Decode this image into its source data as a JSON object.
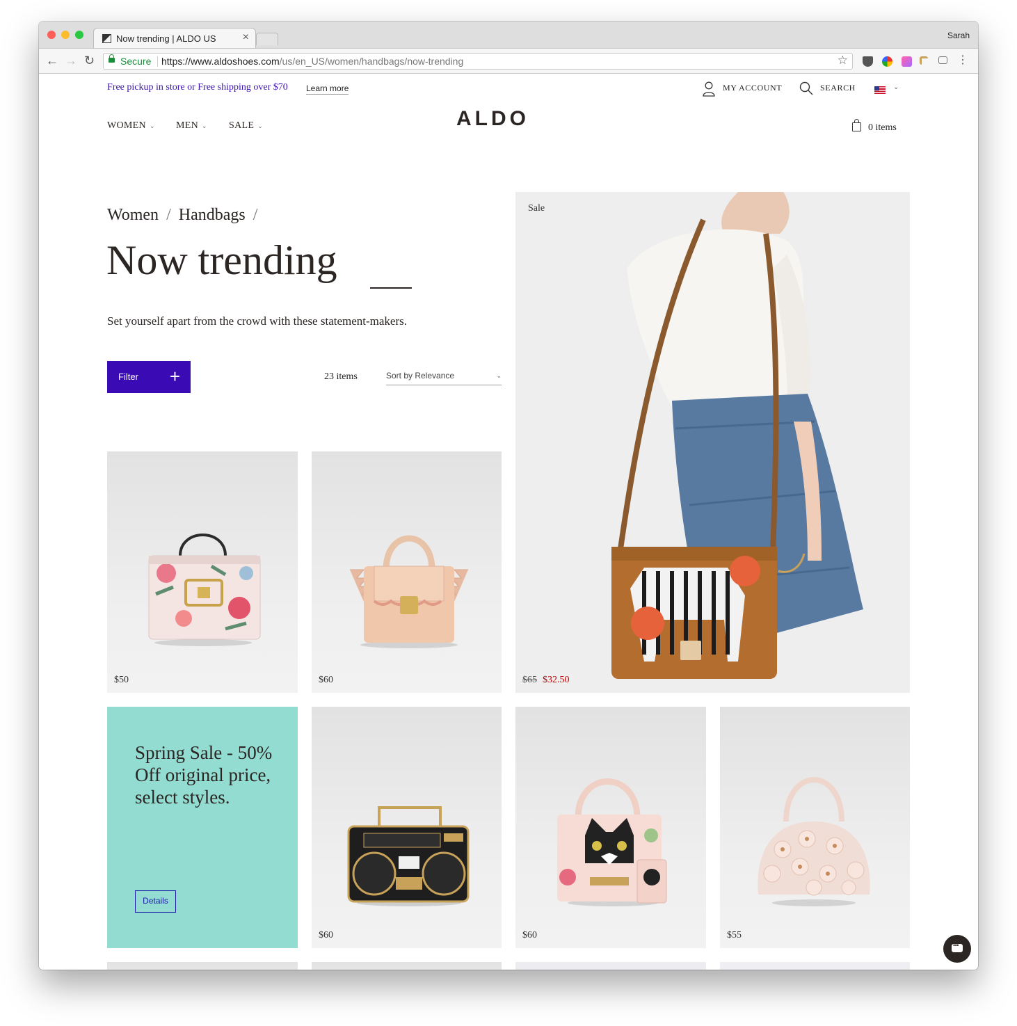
{
  "browser": {
    "tab_title": "Now trending | ALDO US",
    "tab_close": "×",
    "user": "Sarah",
    "secure_label": "Secure",
    "url_host": "https://www.aldoshoes.com",
    "url_path": "/us/en_US/women/handbags/now-trending",
    "nav": {
      "back": "←",
      "forward": "→",
      "reload": "↻",
      "star": "☆",
      "menu": "⋮"
    },
    "colors": {
      "close": "#fc5f57",
      "minimize": "#fdbc2e",
      "maximize": "#28c840"
    }
  },
  "header": {
    "promo_text": "Free pickup in store or Free shipping over $70",
    "learn_more": "Learn more",
    "account": "MY ACCOUNT",
    "search": "SEARCH",
    "logo": "ALDO",
    "cart": "0 items",
    "nav": [
      {
        "label": "WOMEN",
        "chevron": "⌄"
      },
      {
        "label": "MEN",
        "chevron": "⌄"
      },
      {
        "label": "SALE",
        "chevron": "⌄"
      }
    ],
    "flag_chevron": "⌄"
  },
  "breadcrumb": {
    "items": [
      "Women",
      "Handbags"
    ],
    "separator": "/"
  },
  "page": {
    "title": "Now trending",
    "subtitle": "Set yourself apart from the crowd with these statement-makers."
  },
  "controls": {
    "filter_label": "Filter",
    "filter_icon": "+",
    "item_count": "23 items",
    "sort_label": "Sort by Relevance",
    "sort_chevron": "⌄"
  },
  "products": [
    {
      "name": "floral-handbag",
      "price": "$50"
    },
    {
      "name": "ruffle-handbag",
      "price": "$60"
    },
    {
      "name": "zebra-crossbody",
      "badge": "Sale",
      "old_price": "$65",
      "sale_price": "$32.50"
    },
    {
      "name": "boombox-bag",
      "price": "$60"
    },
    {
      "name": "cat-handbag",
      "price": "$60"
    },
    {
      "name": "flower-dome-bag",
      "price": "$55"
    }
  ],
  "promo_card": {
    "title": "Spring Sale - 50% Off original price, select styles.",
    "button": "Details",
    "color": "#92dcd1"
  },
  "accent": "#3a0bb5"
}
